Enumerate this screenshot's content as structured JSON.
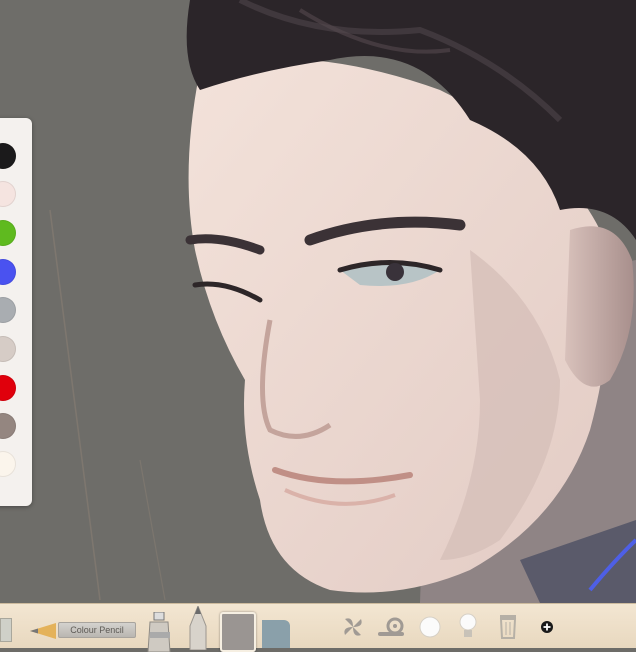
{
  "palette": {
    "colors": [
      "#1b1a1b",
      "#f5e4e0",
      "#5fba1f",
      "#4a52f0",
      "#a9adb1",
      "#d6ccc6",
      "#e0000c",
      "#948680",
      "#fbf5ec"
    ],
    "selected_index": 1
  },
  "toolbar": {
    "pencil_label": "Colour Pencil",
    "tools": [
      "tube-icon",
      "pen-tip-icon",
      "eraser-block",
      "paper-swatch"
    ],
    "actions": [
      "fan-icon",
      "snail-icon",
      "circle-icon",
      "bulb-icon",
      "trash-icon",
      "plus-icon"
    ]
  },
  "colors": {
    "toolbar_bg": "#efe1cb",
    "canvas_bg": "#6d6c68"
  }
}
